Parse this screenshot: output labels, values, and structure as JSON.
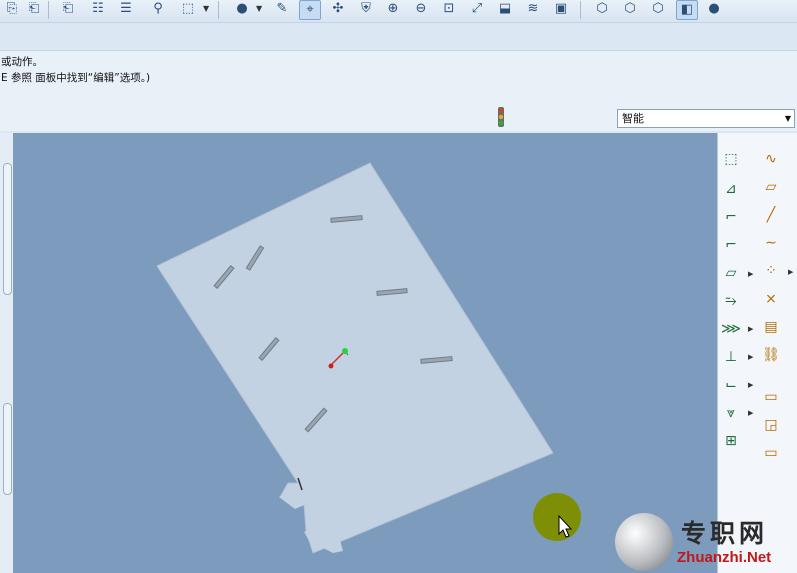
{
  "toolbar": {
    "buttons": [
      {
        "icon": "copy-icon",
        "glyph": "⎘"
      },
      {
        "icon": "paste-icon",
        "glyph": "⎗"
      },
      {
        "icon": "paste-special-icon",
        "glyph": "⎗"
      },
      {
        "icon": "model-tree-icon",
        "glyph": "☷"
      },
      {
        "icon": "layer-tree-icon",
        "glyph": "☰"
      },
      {
        "icon": "find-icon",
        "glyph": "⚲"
      },
      {
        "icon": "selection-box-icon",
        "glyph": "⬚"
      },
      {
        "icon": "shading-icon",
        "glyph": "●"
      },
      {
        "icon": "sketch-icon",
        "glyph": "✎"
      },
      {
        "icon": "datum-display-icon",
        "glyph": "⌖"
      },
      {
        "icon": "spin-center-icon",
        "glyph": "✣"
      },
      {
        "icon": "orient-icon",
        "glyph": "⛨"
      },
      {
        "icon": "zoom-in-icon",
        "glyph": "⊕"
      },
      {
        "icon": "zoom-out-icon",
        "glyph": "⊖"
      },
      {
        "icon": "refit-icon",
        "glyph": "⊡"
      },
      {
        "icon": "reorient-icon",
        "glyph": "⤢"
      },
      {
        "icon": "saved-views-icon",
        "glyph": "⬓"
      },
      {
        "icon": "layers-icon",
        "glyph": "≋"
      },
      {
        "icon": "view-manager-icon",
        "glyph": "▣"
      },
      {
        "icon": "wireframe-icon",
        "glyph": "⬡"
      },
      {
        "icon": "hidden-line-icon",
        "glyph": "⬡"
      },
      {
        "icon": "no-hidden-icon",
        "glyph": "⬡"
      },
      {
        "icon": "shaded-icon",
        "glyph": "◧"
      },
      {
        "icon": "appearance-icon",
        "glyph": "●"
      }
    ]
  },
  "messages": {
    "line1": "或动作。",
    "line2": "E 参照 面板中找到“编辑”选项。)"
  },
  "filter": {
    "selected": "智能"
  },
  "right_toolbar": {
    "col1": [
      "datum-plane-icon",
      "datum-axis-icon",
      "datum-curve-icon",
      "datum-point-icon",
      "extrude-icon",
      "flange-icon",
      "revolve-icon",
      "unbend-icon",
      "bend-icon",
      "bend-back-icon",
      "flat-pattern-icon"
    ],
    "col2": [
      "sketch-curve-icon",
      "plane-icon",
      "axis-icon",
      "curve-icon",
      "point-icon",
      "coordinate-system-icon",
      "analysis-icon",
      "chain-icon",
      "note-icon",
      "annotation-icon",
      "annotation-element-icon"
    ]
  },
  "watermark": {
    "brand_cn": "专职网",
    "url": "Zhuanzhi.Net"
  }
}
